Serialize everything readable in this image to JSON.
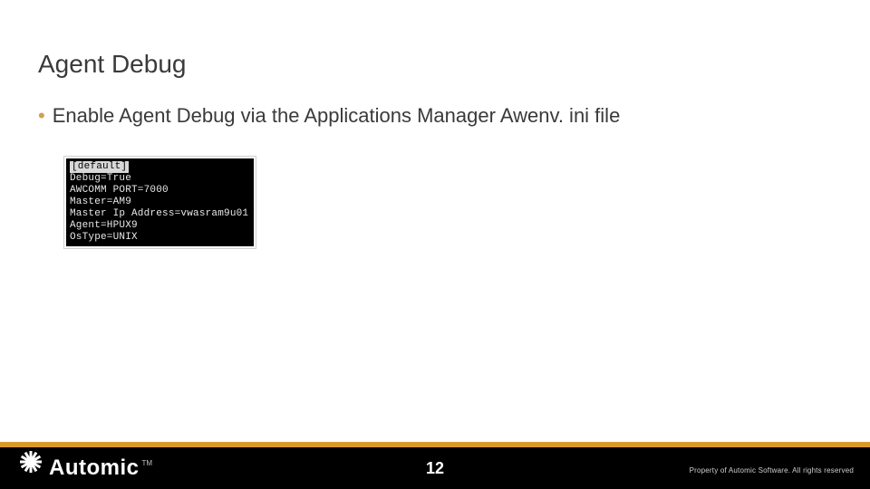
{
  "title": "Agent Debug",
  "bullet": {
    "dot": "•",
    "text": "Enable Agent Debug via the Applications Manager Awenv. ini file"
  },
  "terminal": {
    "header": "[default]",
    "lines": [
      "Debug=True",
      "AWCOMM PORT=7000",
      "Master=AM9",
      "Master Ip Address=vwasram9u01",
      "Agent=HPUX9",
      "OsType=UNIX"
    ]
  },
  "footer": {
    "logo_text": "Automic",
    "tm": "TM",
    "page_number": "12",
    "copyright": "Property of Automic Software. All rights reserved"
  }
}
